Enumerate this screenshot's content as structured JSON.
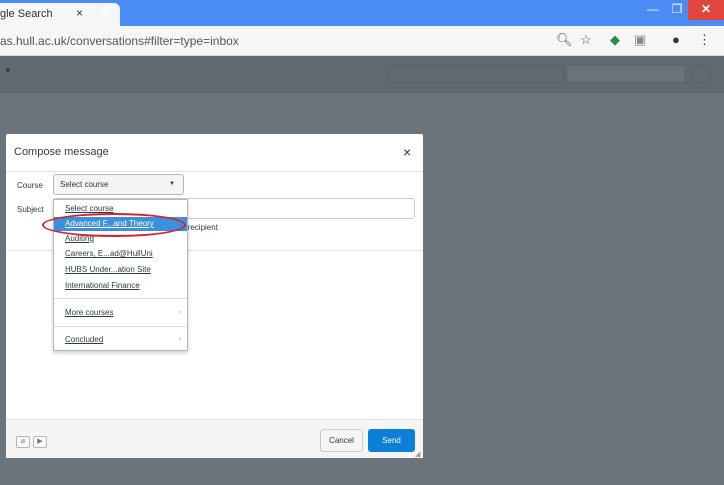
{
  "browser": {
    "tab_title": "gle Search",
    "tab_close": "×",
    "new_tab": "+",
    "url": "as.hull.ac.uk/conversations#filter=type=inbox",
    "window_minimize": "—",
    "window_restore": "❐",
    "window_close": "✕"
  },
  "modal": {
    "title": "Compose message",
    "close": "×",
    "course_label": "Course",
    "course_value": "Select course",
    "subject_label": "Subject",
    "recipient_note": "h recipient",
    "cancel_label": "Cancel",
    "send_label": "Send"
  },
  "dropdown": {
    "items": [
      {
        "label": "Select course"
      },
      {
        "label": "Advanced F...and Theory"
      },
      {
        "label": "Auditing"
      },
      {
        "label": "Careers, E...ad@HullUni"
      },
      {
        "label": "HUBS Under...ation Site"
      },
      {
        "label": "International Finance"
      },
      {
        "label": "More courses"
      },
      {
        "label": "Concluded"
      }
    ],
    "selected_index": 1
  },
  "colors": {
    "accent": "#0c80d8",
    "selected": "#3b8fdb",
    "annotation": "#d4222b",
    "chrome": "#4b8bf4"
  }
}
